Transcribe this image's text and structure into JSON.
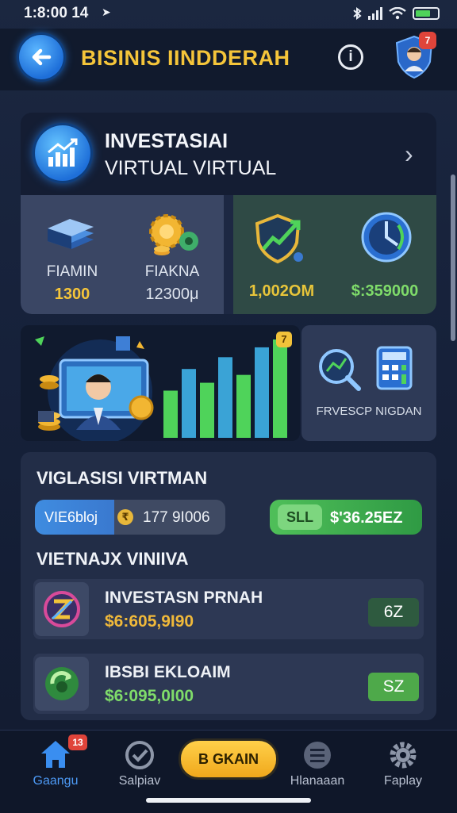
{
  "status_bar": {
    "time": "1:8:00 14",
    "location_glyph": "➤",
    "battery_percent": 70
  },
  "header": {
    "title": "BISINIS IINDDERAH",
    "info_glyph": "i",
    "notification_count": "7"
  },
  "investment_card": {
    "title_line1": "INVESTASIAI",
    "title_line2": "VIRTUAL VIRTUAL",
    "chevron": "›",
    "left_tile": [
      {
        "label": "FIAMIN",
        "value": "1300",
        "value_color": "#f5c53a",
        "icon": "book-stack-icon"
      },
      {
        "label": "FIAKNA",
        "value": "12300μ",
        "value_color": "#dfe5ef",
        "icon": "gear-coins-icon"
      }
    ],
    "right_tile": [
      {
        "value": "1,002OM",
        "value_color": "#e8c53a",
        "icon": "shield-growth-icon"
      },
      {
        "value": "$:359000",
        "value_color": "#7fdc6a",
        "icon": "compass-icon"
      }
    ]
  },
  "banner": {
    "badge": "7",
    "side_label": "FRVESCP NIGDAN",
    "bar_levels": [
      48,
      70,
      56,
      82,
      64,
      92,
      100
    ]
  },
  "panel": {
    "section1_title": "VIGLASISI VIRTMAN",
    "blue_pill": {
      "label": "VIE6bloj",
      "coin_glyph": "₹",
      "value": "177 9I006"
    },
    "green_pill": {
      "tag": "SLL",
      "value": "$'36.25EZ"
    },
    "section2_title": "VIETNAJX VINIIVA",
    "rows": [
      {
        "name": "INVESTASN PRNAH",
        "amount": "$6:605,9I90",
        "amount_color": "#f0b93a",
        "badge": "6Z",
        "badge_bg": "#2e5a3f",
        "icon": "z-coin-icon"
      },
      {
        "name": "IBSBI EKLOAIM",
        "amount": "$6:095,0I00",
        "amount_color": "#7fdc6a",
        "badge": "SZ",
        "badge_bg": "#4ea94a",
        "icon": "refresh-coin-icon"
      }
    ]
  },
  "nav": {
    "items": [
      {
        "label": "Gaangu",
        "icon": "home-icon",
        "badge": "13",
        "active": true
      },
      {
        "label": "Salpiav",
        "icon": "check-circle-icon"
      },
      {
        "label": "Hlanaaan",
        "icon": "list-icon"
      },
      {
        "label": "Faplay",
        "icon": "gear-icon"
      }
    ],
    "center_button": "B GKAIN"
  }
}
